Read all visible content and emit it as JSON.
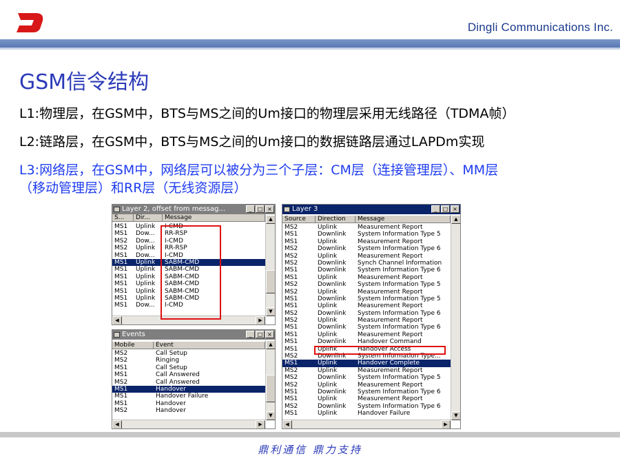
{
  "header": {
    "company": "Dingli Communications Inc.",
    "brand_color": "#1a3a8c",
    "logo_color": "#d81818"
  },
  "slide": {
    "title": "GSM信令结构",
    "line1": "L1:物理层，在GSM中，BTS与MS之间的Um接口的物理层采用无线路径（TDMA帧）",
    "line2": "L2:链路层，在GSM中，BTS与MS之间的Um接口的数据链路层通过LAPDm实现",
    "line3a": "L3:网络层，在GSM中，网络层可以被分为三个子层：CM层（连接管理层）、MM层",
    "line3b": "（移动管理层）和RR层（无线资源层）"
  },
  "layer2": {
    "title": "Layer 2, offset from messag...",
    "columns": [
      "S...",
      "Dir...",
      "Message"
    ],
    "rows": [
      [
        "MS1",
        "Uplink",
        "I-CMD"
      ],
      [
        "MS1",
        "Dow...",
        "RR-RSP"
      ],
      [
        "MS2",
        "Dow...",
        "I-CMD"
      ],
      [
        "MS2",
        "Uplink",
        "RR-RSP"
      ],
      [
        "MS1",
        "Dow...",
        "I-CMD"
      ],
      [
        "MS1",
        "Uplink",
        "SABM-CMD"
      ],
      [
        "MS1",
        "Uplink",
        "SABM-CMD"
      ],
      [
        "MS1",
        "Uplink",
        "SABM-CMD"
      ],
      [
        "MS1",
        "Uplink",
        "SABM-CMD"
      ],
      [
        "MS1",
        "Uplink",
        "SABM-CMD"
      ],
      [
        "MS1",
        "Uplink",
        "SABM-CMD"
      ],
      [
        "MS1",
        "Dow...",
        "I-CMD"
      ]
    ],
    "selected_index": 5
  },
  "events": {
    "title": "Events",
    "columns": [
      "Mobile",
      "Event"
    ],
    "rows": [
      [
        "MS2",
        "Call Setup"
      ],
      [
        "MS2",
        "Ringing"
      ],
      [
        "MS1",
        "Call Setup"
      ],
      [
        "MS1",
        "Call Answered"
      ],
      [
        "MS2",
        "Call Answered"
      ],
      [
        "MS1",
        "Handover"
      ],
      [
        "MS1",
        "Handover Failure"
      ],
      [
        "MS1",
        "Handover"
      ],
      [
        "MS2",
        "Handover"
      ]
    ],
    "selected_index": 5
  },
  "layer3": {
    "title": "Layer 3",
    "columns": [
      "Source",
      "Direction",
      "Message"
    ],
    "rows": [
      [
        "MS2",
        "Uplink",
        "Measurement Report"
      ],
      [
        "MS1",
        "Downlink",
        "System Information Type 5"
      ],
      [
        "MS1",
        "Uplink",
        "Measurement Report"
      ],
      [
        "MS2",
        "Downlink",
        "System Information Type 6"
      ],
      [
        "MS2",
        "Uplink",
        "Measurement Report"
      ],
      [
        "MS2",
        "Downlink",
        "Synch Channel Information"
      ],
      [
        "MS1",
        "Downlink",
        "System Information Type 6"
      ],
      [
        "MS1",
        "Uplink",
        "Measurement Report"
      ],
      [
        "MS2",
        "Downlink",
        "System Information Type 5"
      ],
      [
        "MS2",
        "Uplink",
        "Measurement Report"
      ],
      [
        "MS1",
        "Downlink",
        "System Information Type 5"
      ],
      [
        "MS1",
        "Uplink",
        "Measurement Report"
      ],
      [
        "MS2",
        "Downlink",
        "System Information Type 6"
      ],
      [
        "MS2",
        "Uplink",
        "Measurement Report"
      ],
      [
        "MS1",
        "Downlink",
        "System Information Type 6"
      ],
      [
        "MS1",
        "Uplink",
        "Measurement Report"
      ],
      [
        "MS1",
        "Downlink",
        "Handover Command"
      ],
      [
        "MS1",
        "Uplink",
        "Handover Access"
      ],
      [
        "MS2",
        "Downlink",
        "System Information Type..."
      ],
      [
        "MS1",
        "Uplink",
        "Handover Complete"
      ],
      [
        "MS2",
        "Uplink",
        "Measurement Report"
      ],
      [
        "MS2",
        "Downlink",
        "System Information Type 5"
      ],
      [
        "MS2",
        "Uplink",
        "Measurement Report"
      ],
      [
        "MS1",
        "Downlink",
        "System Information Type 6"
      ],
      [
        "MS1",
        "Uplink",
        "Measurement Report"
      ],
      [
        "MS2",
        "Downlink",
        "System Information Type 6"
      ],
      [
        "MS1",
        "Uplink",
        "Handover Failure"
      ]
    ],
    "selected_index": 19
  },
  "window_buttons": {
    "minimize": "_",
    "maximize": "□",
    "close": "×"
  },
  "footer": {
    "slogan": "鼎利通信 鼎力支持"
  }
}
